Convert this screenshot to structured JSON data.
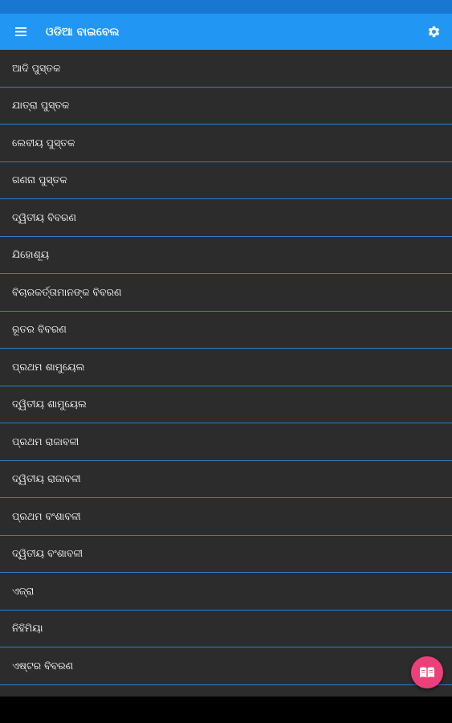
{
  "app_bar": {
    "title": "ଓଡିଆ ବାଇବେଲ",
    "menu_icon": "hamburger-menu-icon",
    "settings_icon": "gear-icon",
    "background": "#2196f3",
    "status_bar_color": "#1976d2"
  },
  "books": [
    {
      "label": "ଆଦି ପୁସ୍ତକ"
    },
    {
      "label": "ଯାତ୍ରା ପୁସ୍ତକ"
    },
    {
      "label": "ଲେବୀୟ ପୁସ୍ତକ"
    },
    {
      "label": "ଗଣନା ପୁସ୍ତକ"
    },
    {
      "label": "ଦ୍ୱିତୀୟ ବିବରଣ"
    },
    {
      "label": "ଯିହୋଶୂୟ"
    },
    {
      "label": "ବିଚାରକର୍ତ୍ତାମାନଙ୍କ ବିବରଣ"
    },
    {
      "label": "ରୂତର ବିବରଣ"
    },
    {
      "label": "ପ୍ରଥମ ଶାମୁୟେଲ"
    },
    {
      "label": "ଦ୍ୱିତୀୟ ଶାମୁୟେଲ"
    },
    {
      "label": "ପ୍ରଥମ ରାଜାବଳୀ"
    },
    {
      "label": "ଦ୍ୱିତୀୟ ରାଜାବଳୀ"
    },
    {
      "label": "ପ୍ରଥମ ବଂଶାବଳୀ"
    },
    {
      "label": "ଦ୍ୱିତୀୟ ବଂଶାବଳୀ"
    },
    {
      "label": "ଏଜ୍ରା"
    },
    {
      "label": "ନିହିମିୟା"
    },
    {
      "label": "ଏଷ୍ଟର ବିବରଣ"
    }
  ],
  "fab": {
    "icon": "open-book-icon",
    "color": "#ec407a"
  },
  "list": {
    "background": "#2c2c2c",
    "divider_color": "#2f7fc6"
  }
}
